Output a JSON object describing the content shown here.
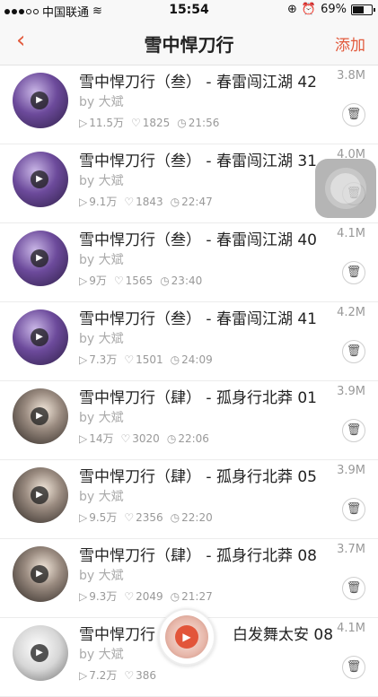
{
  "status_bar": {
    "carrier": "中国联通",
    "time": "15:54",
    "battery": "69%",
    "battery_level": 0.69,
    "signal_bars": 3
  },
  "nav": {
    "back_icon": "chevron-left-icon",
    "title": "雪中悍刀行",
    "add_label": "添加"
  },
  "colors": {
    "accent": "#e25a3c",
    "muted": "#999999"
  },
  "episodes": [
    {
      "title": "雪中悍刀行（叁） - 春雷闯江湖 42",
      "author": "by 大斌",
      "plays": "11.5万",
      "likes": "1825",
      "duration": "21:56",
      "size": "3.8M"
    },
    {
      "title": "雪中悍刀行（叁） - 春雷闯江湖 31",
      "author": "by 大斌",
      "plays": "9.1万",
      "likes": "1843",
      "duration": "22:47",
      "size": "4.0M"
    },
    {
      "title": "雪中悍刀行（叁） - 春雷闯江湖 40",
      "author": "by 大斌",
      "plays": "9万",
      "likes": "1565",
      "duration": "23:40",
      "size": "4.1M"
    },
    {
      "title": "雪中悍刀行（叁） - 春雷闯江湖 41",
      "author": "by 大斌",
      "plays": "7.3万",
      "likes": "1501",
      "duration": "24:09",
      "size": "4.2M"
    },
    {
      "title": "雪中悍刀行（肆） - 孤身行北莽 01",
      "author": "by 大斌",
      "plays": "14万",
      "likes": "3020",
      "duration": "22:06",
      "size": "3.9M"
    },
    {
      "title": "雪中悍刀行（肆） - 孤身行北莽 05",
      "author": "by 大斌",
      "plays": "9.5万",
      "likes": "2356",
      "duration": "22:20",
      "size": "3.9M"
    },
    {
      "title": "雪中悍刀行（肆） - 孤身行北莽 08",
      "author": "by 大斌",
      "plays": "9.3万",
      "likes": "2049",
      "duration": "21:27",
      "size": "3.7M"
    },
    {
      "title": "雪中悍刀行",
      "title_tail": "白发舞太安 08",
      "author": "by 大斌",
      "plays": "7.2万",
      "likes": "386",
      "duration": "",
      "size": "4.1M"
    }
  ]
}
